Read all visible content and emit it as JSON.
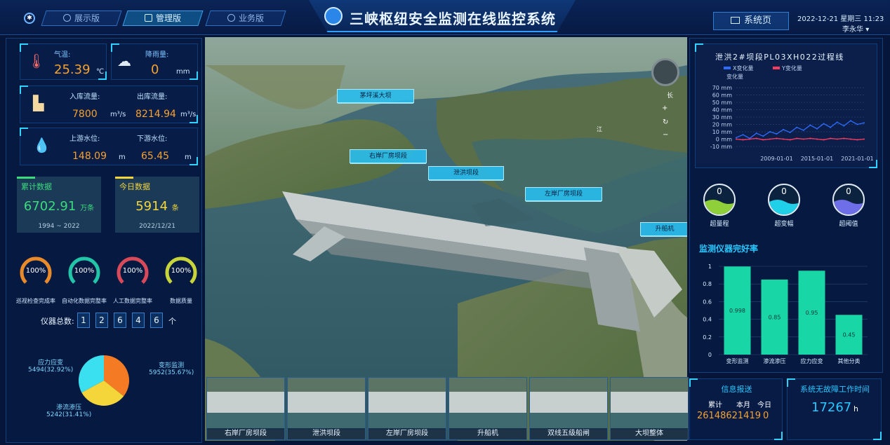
{
  "header": {
    "tabs": [
      {
        "label": "展示版",
        "active": false
      },
      {
        "label": "管理版",
        "active": true
      },
      {
        "label": "业务版",
        "active": false
      }
    ],
    "title": "三峡枢纽安全监测在线监控系统",
    "system_page": "系统页",
    "datetime": "2022-12-21 星期三 11:23",
    "user": "李永华"
  },
  "weather": {
    "temp_label": "气温:",
    "temp_value": "25.39",
    "temp_unit": "℃",
    "rain_label": "降雨量:",
    "rain_value": "0",
    "rain_unit": "mm"
  },
  "flow": {
    "in_label": "入库流量:",
    "in_value": "7800",
    "in_unit": "m³/s",
    "out_label": "出库流量:",
    "out_value": "8214.94",
    "out_unit": "m³/s"
  },
  "water_level": {
    "up_label": "上游水位:",
    "up_value": "148.09",
    "up_unit": "m",
    "down_label": "下游水位:",
    "down_value": "65.45",
    "down_unit": "m"
  },
  "stats": {
    "cumulative": {
      "title": "累计数据",
      "value": "6702.91",
      "unit": "万条",
      "range": "1994 ~ 2022",
      "color": "#3bdc7c"
    },
    "today": {
      "title": "今日数据",
      "value": "5914",
      "unit": "条",
      "date": "2022/12/21",
      "color": "#f5d63a"
    }
  },
  "gauges": [
    {
      "label": "100%",
      "caption": "巡视检查完成率",
      "percent": 100,
      "color": "#e8892a"
    },
    {
      "label": "100%",
      "caption": "自动化数据完整率",
      "percent": 100,
      "color": "#21c5a8"
    },
    {
      "label": "100%",
      "caption": "人工数据完整率",
      "percent": 100,
      "color": "#d84a5a"
    },
    {
      "label": "100%",
      "caption": "数据质量",
      "percent": 100,
      "color": "#c7d43a"
    }
  ],
  "instrument_total": {
    "label": "仪器总数:",
    "digits": [
      "1",
      "2",
      "6",
      "4",
      "6"
    ],
    "unit": "个"
  },
  "pie": {
    "type": "pie",
    "slices": [
      {
        "name": "应力应变",
        "value": 5494,
        "percent": "32.92%",
        "label": "5494(32.92%)",
        "color": "#3be0f0"
      },
      {
        "name": "变形监测",
        "value": 5952,
        "percent": "35.67%",
        "label": "5952(35.67%)",
        "color": "#f47a23"
      },
      {
        "name": "渗流渗压",
        "value": 5242,
        "percent": "31.41%",
        "label": "5242(31.41%)",
        "color": "#f5d63a"
      }
    ]
  },
  "map": {
    "labels": [
      {
        "text": "茅坪溪大坝"
      },
      {
        "text": "右岸厂房坝段"
      },
      {
        "text": "泄洪坝段"
      },
      {
        "text": "左岸厂房坝段"
      },
      {
        "text": "升船机"
      }
    ],
    "compass_label": "长",
    "river_label": "江",
    "controls": [
      "+",
      "↻",
      "−"
    ]
  },
  "thumbnails": [
    "右岸厂房坝段",
    "泄洪坝段",
    "左岸厂房坝段",
    "升船机",
    "双线五级船闸",
    "大坝整体"
  ],
  "chart_data": [
    {
      "type": "line",
      "title": "泄洪2#坝段PL03XH022过程线",
      "ylabel": "变化量",
      "legend": [
        "X变化量",
        "Y变化量"
      ],
      "legend_position": "top",
      "x": [
        "2003-01-01",
        "2004-01-01",
        "2005-01-01",
        "2006-01-01",
        "2007-01-01",
        "2008-01-01",
        "2009-01-01",
        "2010-01-01",
        "2011-01-01",
        "2012-01-01",
        "2013-01-01",
        "2014-01-01",
        "2015-01-01",
        "2016-01-01",
        "2017-01-01",
        "2018-01-01",
        "2019-01-01",
        "2020-01-01",
        "2021-01-01",
        "2022-01-01"
      ],
      "xticks": [
        "2009-01-01",
        "2015-01-01",
        "2021-01-01"
      ],
      "yticks": [
        "70 mm",
        "60 mm",
        "50 mm",
        "40 mm",
        "30 mm",
        "20 mm",
        "10 mm",
        "0 mm",
        "-10 mm"
      ],
      "ylim": [
        -10,
        70
      ],
      "series": [
        {
          "name": "X变化量",
          "color": "#2f6bff",
          "values": [
            2,
            6,
            1,
            8,
            4,
            10,
            7,
            13,
            9,
            16,
            12,
            19,
            14,
            21,
            16,
            23,
            18,
            25,
            20,
            22
          ]
        },
        {
          "name": "Y变化量",
          "color": "#ff3a5c",
          "values": [
            0,
            -1,
            0,
            1,
            -1,
            0,
            1,
            0,
            -1,
            1,
            0,
            1,
            0,
            -1,
            1,
            0,
            1,
            0,
            -1,
            0
          ]
        }
      ],
      "grid": true
    },
    {
      "type": "bar",
      "title": "监测仪器完好率",
      "categories": [
        "变形监测",
        "渗流渗压",
        "应力应变",
        "其他分类"
      ],
      "values": [
        0.998,
        0.85,
        0.95,
        0.45
      ],
      "labels": [
        "0.998",
        "0.85",
        "0.95",
        "0.45"
      ],
      "yticks": [
        "1",
        "0.8",
        "0.6",
        "0.4",
        "0.2",
        "0"
      ],
      "ylim": [
        0,
        1
      ],
      "color": "#18d6a5"
    }
  ],
  "bubbles": [
    {
      "value": "0",
      "caption": "超量程",
      "color": "#8fd03a"
    },
    {
      "value": "0",
      "caption": "超变幅",
      "color": "#1fd0e8"
    },
    {
      "value": "0",
      "caption": "超阈值",
      "color": "#6e6ee8"
    }
  ],
  "report": {
    "title": "信息报送",
    "cols": [
      "累计",
      "本月",
      "今日"
    ],
    "total": "26148621419",
    "month": "0",
    "today": ""
  },
  "uptime": {
    "title": "系统无故障工作时间",
    "value": "17267",
    "unit": "h"
  }
}
